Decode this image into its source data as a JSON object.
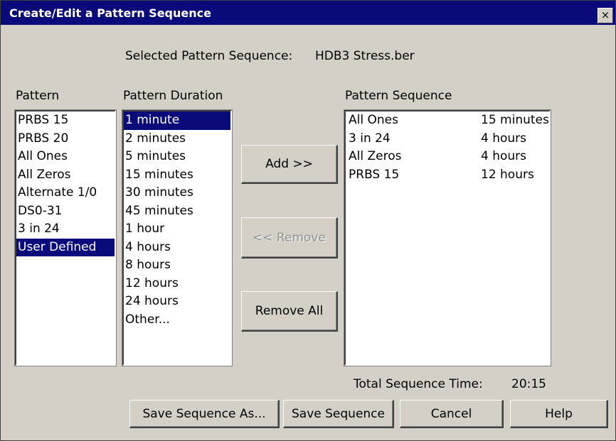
{
  "window": {
    "title": "Create/Edit a Pattern Sequence",
    "close_label": "×"
  },
  "selected_sequence": {
    "label": "Selected Pattern Sequence:",
    "value": "HDB3 Stress.ber"
  },
  "pattern": {
    "header": "Pattern",
    "items": [
      "PRBS 15",
      "PRBS 20",
      "All Ones",
      "All Zeros",
      "Alternate 1/0",
      "DS0-31",
      "3 in 24",
      "User Defined"
    ],
    "selected": "User Defined"
  },
  "duration": {
    "header": "Pattern Duration",
    "items": [
      "1 minute",
      "2 minutes",
      "5 minutes",
      "15 minutes",
      "30 minutes",
      "45 minutes",
      "1 hour",
      "4 hours",
      "8 hours",
      "12 hours",
      "24 hours",
      "Other..."
    ],
    "selected": "1 minute"
  },
  "sequence": {
    "header": "Pattern Sequence",
    "rows": [
      {
        "pattern": "All Ones",
        "duration": "15 minutes"
      },
      {
        "pattern": "3 in 24",
        "duration": "4 hours"
      },
      {
        "pattern": "All Zeros",
        "duration": "4 hours"
      },
      {
        "pattern": "PRBS 15",
        "duration": "12 hours"
      }
    ]
  },
  "buttons": {
    "add": "Add >>",
    "remove": "<< Remove",
    "remove_all": "Remove All",
    "save_as": "Save Sequence As...",
    "save": "Save Sequence",
    "cancel": "Cancel",
    "help": "Help"
  },
  "total": {
    "label": "Total Sequence Time:",
    "value": "20:15"
  },
  "colors": {
    "titlebar": "#0a0a7a",
    "selection": "#0a0a7a",
    "face": "#d4d0c8"
  }
}
